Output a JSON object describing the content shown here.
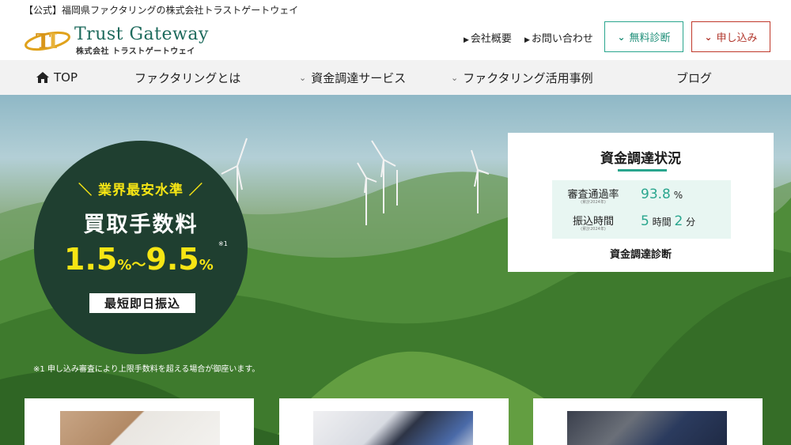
{
  "header": {
    "tagline": "【公式】福岡県ファクタリングの株式会社トラストゲートウェイ",
    "logo_title": "Trust Gateway",
    "logo_sub": "株式会社 トラストゲートウェイ",
    "links": [
      "会社概要",
      "お問い合わせ"
    ],
    "free_diagnosis": "無料診断",
    "apply": "申し込み",
    "accent_green": "#2aa68e",
    "accent_red": "#c0392b"
  },
  "nav": {
    "home": "TOP",
    "factoring": "ファクタリングとは",
    "finance": "資金調達サービス",
    "cases": "ファクタリング活用事例",
    "blog": "ブログ"
  },
  "hero": {
    "tag": "＼ 業界最安水準 ／",
    "title": "買取手数料",
    "rate_low": "1.5",
    "rate_sep": "%～",
    "rate_high": "9.5",
    "rate_unit": "%",
    "rate_note": "※1",
    "badge": "最短即日振込",
    "footnote": "※1 申し込み審査により上限手数料を超える場合が御座います。"
  },
  "status": {
    "title": "資金調達状況",
    "approval_label": "審査通過率",
    "approval_sub": "(累計2024年)",
    "approval_value": "93.8",
    "approval_unit": "%",
    "transfer_label": "振込時間",
    "transfer_sub": "(累計2024年)",
    "transfer_hours": "5",
    "transfer_hours_unit": "時間",
    "transfer_minutes": "2",
    "transfer_minutes_unit": "分",
    "link": "資金調達診断"
  }
}
